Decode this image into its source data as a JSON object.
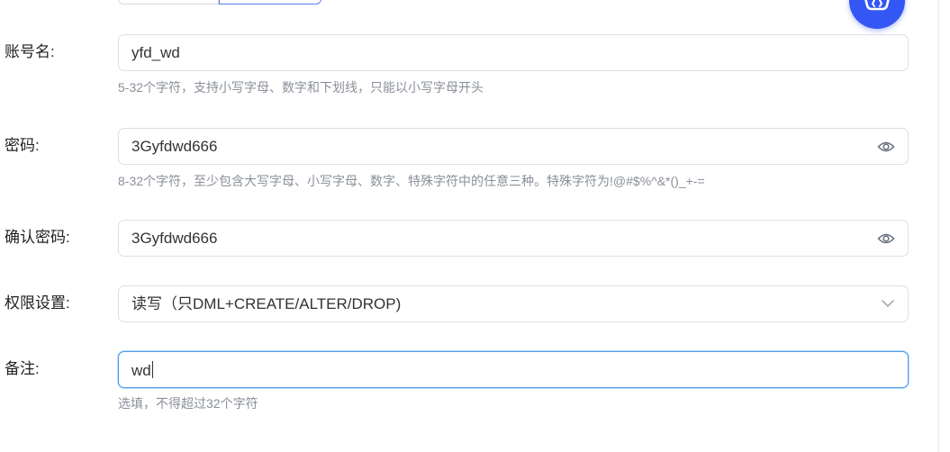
{
  "form": {
    "account": {
      "label": "账号名:",
      "value": "yfd_wd",
      "hint": "5-32个字符，支持小写字母、数字和下划线，只能以小写字母开头"
    },
    "password": {
      "label": "密码:",
      "value": "3Gyfdwd666",
      "hint": "8-32个字符，至少包含大写字母、小写字母、数字、特殊字符中的任意三种。特殊字符为!@#$%^&*()_+-="
    },
    "confirm_password": {
      "label": "确认密码:",
      "value": "3Gyfdwd666"
    },
    "permission": {
      "label": "权限设置:",
      "selected": "读写（只DML+CREATE/ALTER/DROP)"
    },
    "remark": {
      "label": "备注:",
      "value": "wd",
      "hint": "选填，不得超过32个字符"
    }
  },
  "icons": {
    "password_toggle": "eye-icon",
    "confirm_password_toggle": "eye-icon",
    "dropdown": "chevron-down-icon",
    "assistant": "assistant-icon"
  },
  "colors": {
    "accent": "#3456f5",
    "focus_border": "#4a9cf0",
    "hint_text": "#8a8f99",
    "input_border": "#dcdfe6"
  }
}
